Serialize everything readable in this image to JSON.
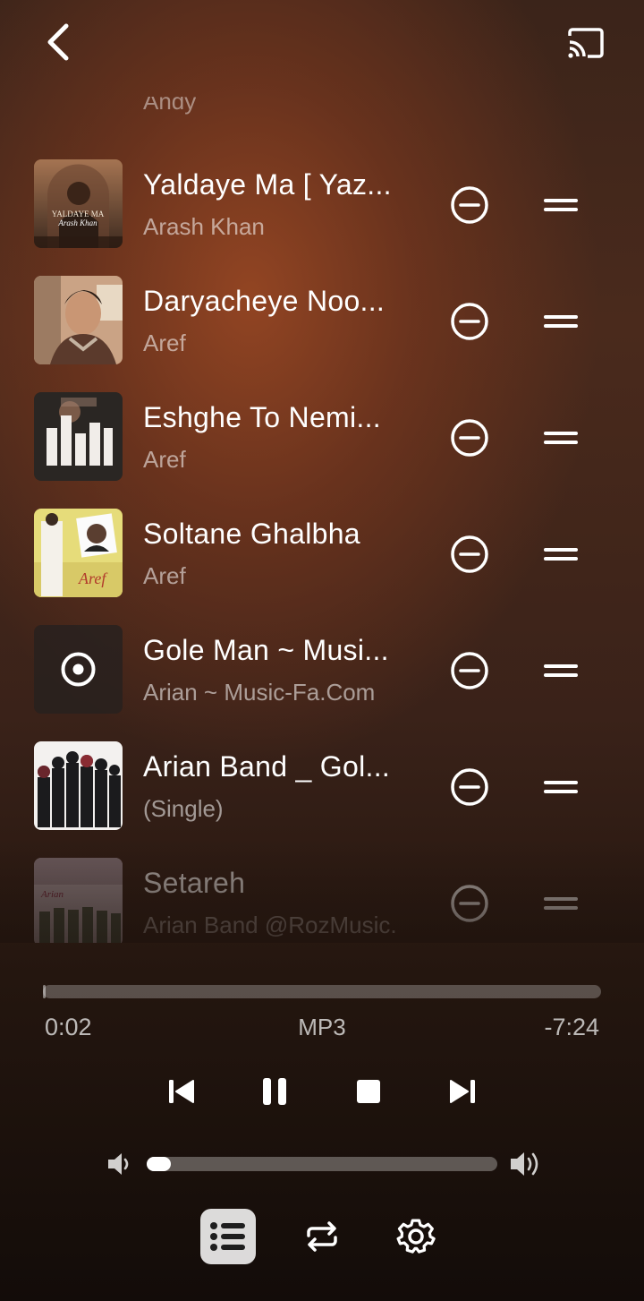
{
  "header": {
    "back_icon": "chevron-left-icon",
    "cast_icon": "cast-icon",
    "partial_artist": "Andy"
  },
  "queue": [
    {
      "title": "Yaldaye Ma [ Yaz...",
      "artist": "Arash Khan",
      "cover_text": "YALDAYE MA",
      "cover_sub": "Arash Khan"
    },
    {
      "title": "Daryacheye Noo...",
      "artist": "Aref"
    },
    {
      "title": "Eshghe To Nemi...",
      "artist": "Aref"
    },
    {
      "title": "Soltane Ghalbha",
      "artist": "Aref",
      "cover_text": "Aref"
    },
    {
      "title": "Gole Man ~ Musi...",
      "artist": "Arian ~ Music-Fa.Com"
    },
    {
      "title": "Arian Band _ Gol...",
      "artist": "(Single)"
    },
    {
      "title": "Setareh",
      "artist": "Arian Band @RozMusic.",
      "cover_text": "Arian"
    }
  ],
  "player": {
    "progress": 0.005,
    "elapsed": "0:02",
    "format": "MP3",
    "remaining": "-7:24",
    "volume": 0.07
  },
  "controls": {
    "previous_icon": "skip-previous-icon",
    "pause_icon": "pause-icon",
    "stop_icon": "stop-icon",
    "next_icon": "skip-next-icon",
    "volume_low_icon": "volume-low-icon",
    "volume_high_icon": "volume-high-icon",
    "playlist_icon": "playlist-icon",
    "repeat_icon": "repeat-icon",
    "settings_icon": "settings-gear-icon"
  },
  "colors": {
    "accent": "#ffffff",
    "background_warm": "#8a4022",
    "background_dark": "#130c09"
  }
}
